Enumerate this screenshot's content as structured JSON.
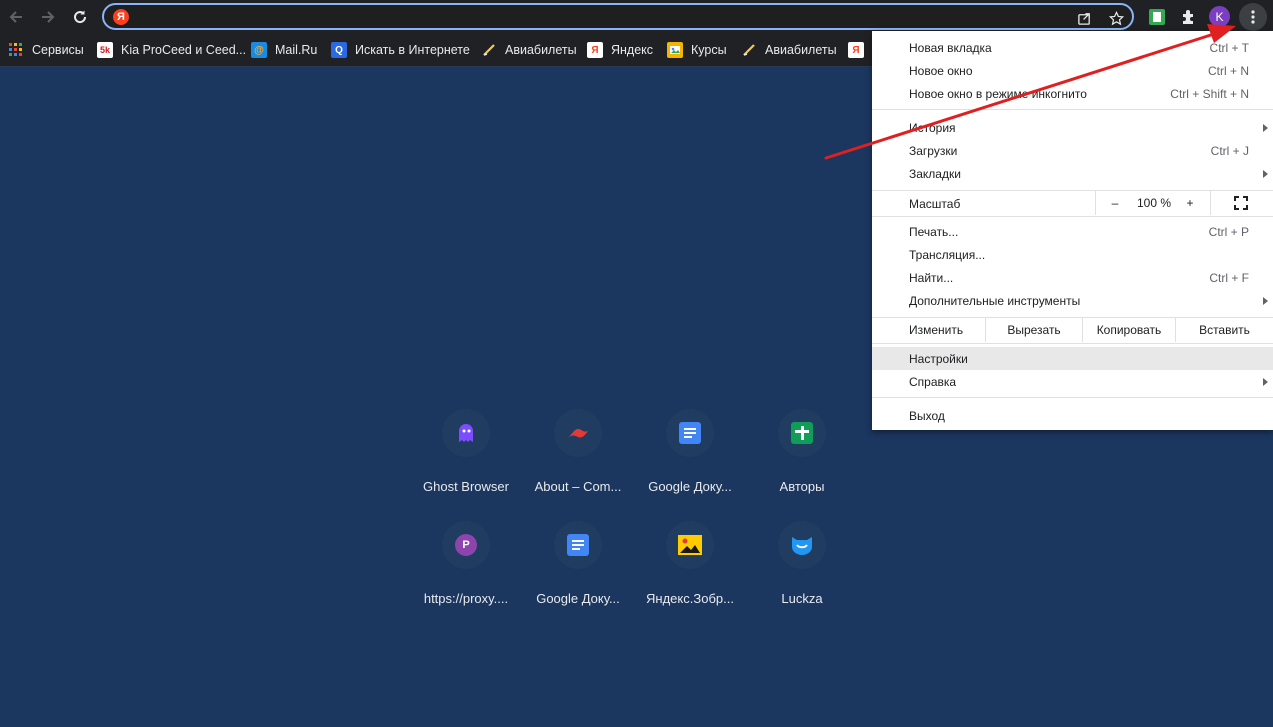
{
  "toolbar": {
    "back_icon": "arrow-left-icon",
    "forward_icon": "arrow-right-icon",
    "reload_icon": "reload-icon",
    "omnibox_logo": "Я",
    "avatar_letter": "K"
  },
  "bookmarks": [
    {
      "label": "Сервисы",
      "icon": "apps-grid-icon"
    },
    {
      "label": "Kia ProCeed и Ceed...",
      "icon": "5k-icon",
      "fav": "5k"
    },
    {
      "label": "Mail.Ru",
      "icon": "mailru-icon",
      "fav": "@"
    },
    {
      "label": "Искать в Интернете",
      "icon": "search-icon",
      "fav": "Q"
    },
    {
      "label": "Авиабилеты",
      "icon": "plane-icon"
    },
    {
      "label": "Яндекс",
      "icon": "yandex-icon",
      "fav": "Я"
    },
    {
      "label": "Курсы",
      "icon": "image-icon"
    },
    {
      "label": "Авиабилеты",
      "icon": "plane-icon"
    },
    {
      "label": "",
      "icon": "yandex-icon",
      "fav": "Я"
    }
  ],
  "shortcuts": [
    {
      "label": "Ghost Browser",
      "icon": "ghost-icon"
    },
    {
      "label": "About – Com...",
      "icon": "about-icon"
    },
    {
      "label": "Google Доку...",
      "icon": "google-docs-icon"
    },
    {
      "label": "Авторы",
      "icon": "google-sheets-icon"
    },
    {
      "label": "https://proxy....",
      "icon": "proxy-icon",
      "letter": "P"
    },
    {
      "label": "Google Доку...",
      "icon": "google-docs-icon"
    },
    {
      "label": "Яндекс.Зобр...",
      "icon": "yandex-images-icon"
    },
    {
      "label": "Luckza",
      "icon": "luckza-icon"
    }
  ],
  "menu": {
    "new_tab": {
      "label": "Новая вкладка",
      "shortcut": "Ctrl + T"
    },
    "new_window": {
      "label": "Новое окно",
      "shortcut": "Ctrl + N"
    },
    "incognito": {
      "label": "Новое окно в режиме инкогнито",
      "shortcut": "Ctrl + Shift + N"
    },
    "history": {
      "label": "История"
    },
    "downloads": {
      "label": "Загрузки",
      "shortcut": "Ctrl + J"
    },
    "bookmarks": {
      "label": "Закладки"
    },
    "zoom": {
      "label": "Масштаб",
      "minus": "–",
      "value": "100 %",
      "plus": "+"
    },
    "print": {
      "label": "Печать...",
      "shortcut": "Ctrl + P"
    },
    "cast": {
      "label": "Трансляция..."
    },
    "find": {
      "label": "Найти...",
      "shortcut": "Ctrl + F"
    },
    "more_tools": {
      "label": "Дополнительные инструменты"
    },
    "edit": {
      "label": "Изменить",
      "cut": "Вырезать",
      "copy": "Копировать",
      "paste": "Вставить"
    },
    "settings": {
      "label": "Настройки"
    },
    "help": {
      "label": "Справка"
    },
    "exit": {
      "label": "Выход"
    }
  },
  "colors": {
    "page_bg": "#1b365f",
    "toolbar_bg": "#202124",
    "omnibox_border": "#8ab4f8",
    "arrow": "#e02020"
  }
}
